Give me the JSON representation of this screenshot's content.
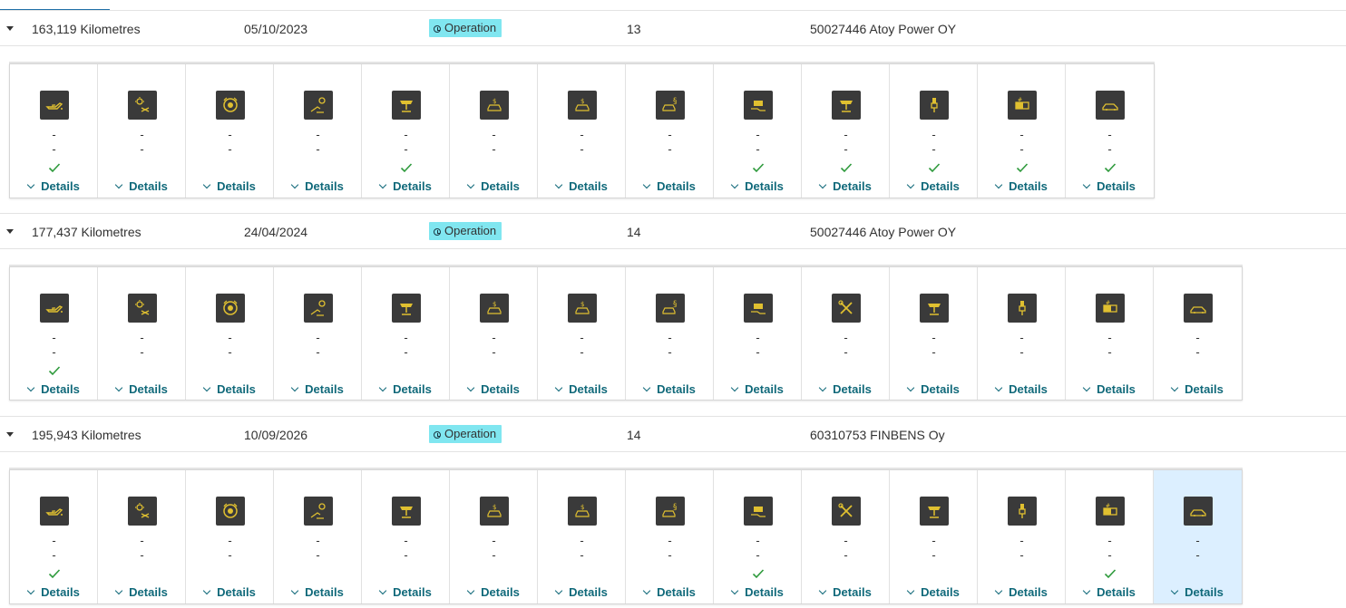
{
  "colors": {
    "accent": "#1f6fa8",
    "badge": "#80e6f0",
    "link": "#10697a",
    "check": "#2e9a3c",
    "icon_fg": "#e0c030",
    "selected": "#dcefff"
  },
  "entries": [
    {
      "odometer": "163,119 Kilometres",
      "date": "05/10/2023",
      "status": "Operation",
      "count": "13",
      "dealer": "50027446 Atoy Power OY",
      "tiles": [
        {
          "icon": "oil-can-icon",
          "line1": "-",
          "line2": "-",
          "done": true,
          "details": "Details"
        },
        {
          "icon": "brake-service-icon",
          "line1": "-",
          "line2": "-",
          "done": false,
          "details": "Details"
        },
        {
          "icon": "brake-disc-icon",
          "line1": "-",
          "line2": "-",
          "done": false,
          "details": "Details"
        },
        {
          "icon": "brake-fluid-icon",
          "line1": "-",
          "line2": "-",
          "done": false,
          "details": "Details"
        },
        {
          "icon": "vehicle-lift-icon",
          "line1": "-",
          "line2": "-",
          "done": true,
          "details": "Details"
        },
        {
          "icon": "inspection-car-icon",
          "line1": "-",
          "line2": "-",
          "done": false,
          "details": "Details"
        },
        {
          "icon": "inspection-car-icon",
          "line1": "-",
          "line2": "-",
          "done": false,
          "details": "Details"
        },
        {
          "icon": "legal-inspection-icon",
          "line1": "-",
          "line2": "-",
          "done": false,
          "details": "Details"
        },
        {
          "icon": "battery-hand-icon",
          "line1": "-",
          "line2": "-",
          "done": true,
          "details": "Details"
        },
        {
          "icon": "vehicle-lift-icon",
          "line1": "-",
          "line2": "-",
          "done": true,
          "details": "Details"
        },
        {
          "icon": "spark-plug-icon",
          "line1": "-",
          "line2": "-",
          "done": true,
          "details": "Details"
        },
        {
          "icon": "battery-icon",
          "line1": "-",
          "line2": "-",
          "done": true,
          "details": "Details"
        },
        {
          "icon": "car-icon",
          "line1": "-",
          "line2": "-",
          "done": true,
          "details": "Details"
        }
      ]
    },
    {
      "odometer": "177,437 Kilometres",
      "date": "24/04/2024",
      "status": "Operation",
      "count": "14",
      "dealer": "50027446 Atoy Power OY",
      "tiles": [
        {
          "icon": "oil-can-icon",
          "line1": "-",
          "line2": "-",
          "done": true,
          "details": "Details"
        },
        {
          "icon": "brake-service-icon",
          "line1": "-",
          "line2": "-",
          "done": false,
          "details": "Details"
        },
        {
          "icon": "brake-disc-icon",
          "line1": "-",
          "line2": "-",
          "done": false,
          "details": "Details"
        },
        {
          "icon": "brake-fluid-icon",
          "line1": "-",
          "line2": "-",
          "done": false,
          "details": "Details"
        },
        {
          "icon": "vehicle-lift-icon",
          "line1": "-",
          "line2": "-",
          "done": false,
          "details": "Details"
        },
        {
          "icon": "inspection-car-icon",
          "line1": "-",
          "line2": "-",
          "done": false,
          "details": "Details"
        },
        {
          "icon": "inspection-car-icon",
          "line1": "-",
          "line2": "-",
          "done": false,
          "details": "Details"
        },
        {
          "icon": "legal-inspection-icon",
          "line1": "-",
          "line2": "-",
          "done": false,
          "details": "Details"
        },
        {
          "icon": "battery-hand-icon",
          "line1": "-",
          "line2": "-",
          "done": false,
          "details": "Details"
        },
        {
          "icon": "tools-icon",
          "line1": "-",
          "line2": "-",
          "done": false,
          "details": "Details"
        },
        {
          "icon": "vehicle-lift-icon",
          "line1": "-",
          "line2": "-",
          "done": false,
          "details": "Details"
        },
        {
          "icon": "spark-plug-icon",
          "line1": "-",
          "line2": "-",
          "done": false,
          "details": "Details"
        },
        {
          "icon": "battery-icon",
          "line1": "-",
          "line2": "-",
          "done": false,
          "details": "Details"
        },
        {
          "icon": "car-icon",
          "line1": "-",
          "line2": "-",
          "done": false,
          "details": "Details"
        }
      ]
    },
    {
      "odometer": "195,943 Kilometres",
      "date": "10/09/2026",
      "status": "Operation",
      "count": "14",
      "dealer": "60310753 FINBENS Oy",
      "tiles": [
        {
          "icon": "oil-can-icon",
          "line1": "-",
          "line2": "-",
          "done": true,
          "details": "Details"
        },
        {
          "icon": "brake-service-icon",
          "line1": "-",
          "line2": "-",
          "done": false,
          "details": "Details"
        },
        {
          "icon": "brake-disc-icon",
          "line1": "-",
          "line2": "-",
          "done": false,
          "details": "Details"
        },
        {
          "icon": "brake-fluid-icon",
          "line1": "-",
          "line2": "-",
          "done": false,
          "details": "Details"
        },
        {
          "icon": "vehicle-lift-icon",
          "line1": "-",
          "line2": "-",
          "done": false,
          "details": "Details"
        },
        {
          "icon": "inspection-car-icon",
          "line1": "-",
          "line2": "-",
          "done": false,
          "details": "Details"
        },
        {
          "icon": "inspection-car-icon",
          "line1": "-",
          "line2": "-",
          "done": false,
          "details": "Details"
        },
        {
          "icon": "legal-inspection-icon",
          "line1": "-",
          "line2": "-",
          "done": false,
          "details": "Details"
        },
        {
          "icon": "battery-hand-icon",
          "line1": "-",
          "line2": "-",
          "done": true,
          "details": "Details"
        },
        {
          "icon": "tools-icon",
          "line1": "-",
          "line2": "-",
          "done": false,
          "details": "Details"
        },
        {
          "icon": "vehicle-lift-icon",
          "line1": "-",
          "line2": "-",
          "done": false,
          "details": "Details"
        },
        {
          "icon": "spark-plug-icon",
          "line1": "-",
          "line2": "-",
          "done": false,
          "details": "Details"
        },
        {
          "icon": "battery-icon",
          "line1": "-",
          "line2": "-",
          "done": true,
          "details": "Details"
        },
        {
          "icon": "car-icon",
          "line1": "-",
          "line2": "-",
          "done": false,
          "details": "Details",
          "selected": true
        }
      ]
    }
  ]
}
